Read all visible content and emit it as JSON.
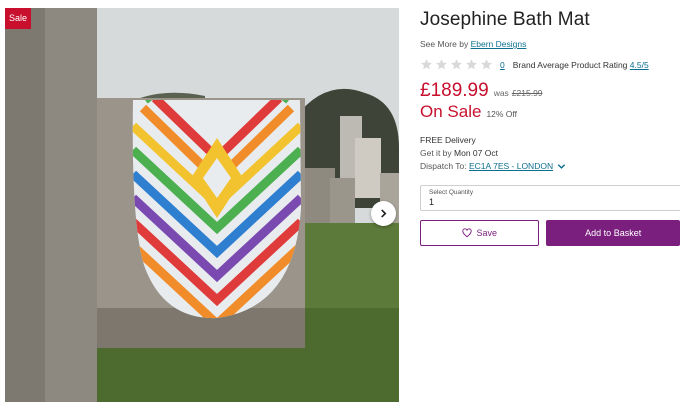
{
  "gallery": {
    "sale_badge": "Sale",
    "image_icon": "product-photo",
    "next_icon": "chevron-right-icon"
  },
  "product": {
    "title": "Josephine Bath Mat",
    "see_more_prefix": "See More by",
    "brand": "Ebern Designs",
    "review_count": "0",
    "rating_label": "Brand Average Product Rating",
    "rating_value": "4.5/5",
    "price": "£189.99",
    "was_label": "was",
    "was_price": "£215.99",
    "on_sale": "On Sale",
    "percent_off": "12% Off"
  },
  "delivery": {
    "free": "FREE Delivery",
    "get_it_prefix": "Get it by",
    "date": "Mon 07 Oct",
    "dispatch_prefix": "Dispatch To:",
    "dispatch_location": "EC1A 7ES - LONDON"
  },
  "quantity": {
    "label": "Select Quantity",
    "value": "1"
  },
  "actions": {
    "save_label": "Save",
    "basket_label": "Add to Basket"
  },
  "colors": {
    "sale_red": "#c8102e",
    "brand_purple": "#7b1f7f",
    "link_teal": "#0d6f8f"
  }
}
